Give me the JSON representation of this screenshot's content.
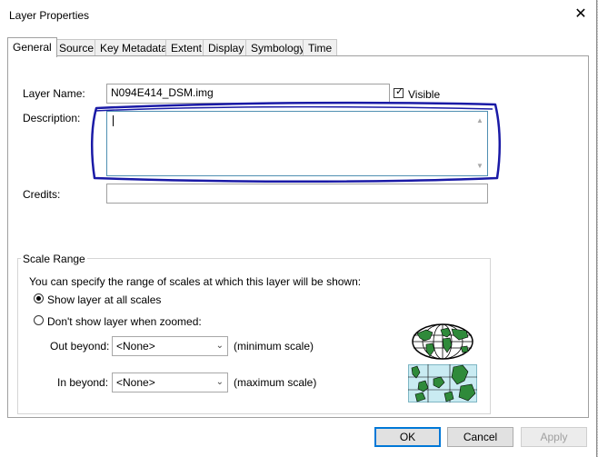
{
  "window": {
    "title": "Layer Properties",
    "close_glyph": "✕"
  },
  "tabs": [
    {
      "label": "General"
    },
    {
      "label": "Source"
    },
    {
      "label": "Key Metadata"
    },
    {
      "label": "Extent"
    },
    {
      "label": "Display"
    },
    {
      "label": "Symbology"
    },
    {
      "label": "Time"
    }
  ],
  "general": {
    "layer_name_label": "Layer Name:",
    "layer_name_value": "N094E414_DSM.img",
    "visible_label": "Visible",
    "visible_checked": true,
    "description_label": "Description:",
    "description_value": "",
    "credits_label": "Credits:",
    "credits_value": ""
  },
  "scale_range": {
    "title": "Scale Range",
    "info": "You can specify the range of scales at which this layer will be shown:",
    "option_all": "Show layer at all scales",
    "option_zoomed": "Don't show layer when zoomed:",
    "selected": "all",
    "out_beyond_label": "Out beyond:",
    "out_beyond_value": "<None>",
    "min_scale_label": "(minimum scale)",
    "in_beyond_label": "In beyond:",
    "in_beyond_value": "<None>",
    "max_scale_label": "(maximum scale)"
  },
  "buttons": {
    "ok": "OK",
    "cancel": "Cancel",
    "apply": "Apply"
  },
  "icons": {
    "out_beyond": "globe-icon",
    "in_beyond": "zoomed-map-icon"
  },
  "colors": {
    "annotation": "#1a1aa6",
    "focus_border": "#0078d7"
  }
}
